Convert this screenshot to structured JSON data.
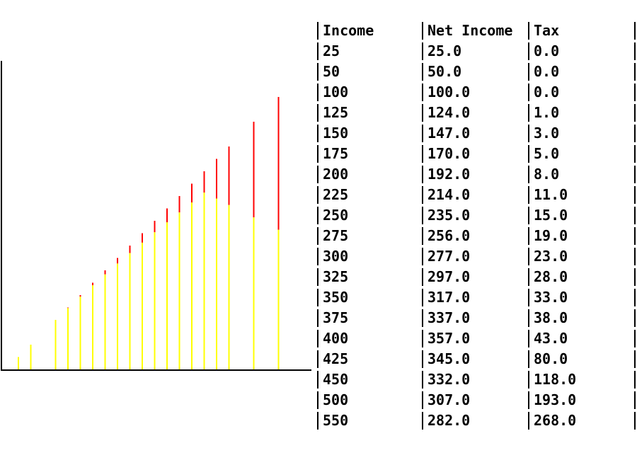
{
  "table": {
    "headers": [
      "Income",
      "Net Income",
      "Tax"
    ],
    "rows": [
      [
        "25",
        "25.0",
        "0.0"
      ],
      [
        "50",
        "50.0",
        "0.0"
      ],
      [
        "100",
        "100.0",
        "0.0"
      ],
      [
        "125",
        "124.0",
        "1.0"
      ],
      [
        "150",
        "147.0",
        "3.0"
      ],
      [
        "175",
        "170.0",
        "5.0"
      ],
      [
        "200",
        "192.0",
        "8.0"
      ],
      [
        "225",
        "214.0",
        "11.0"
      ],
      [
        "250",
        "235.0",
        "15.0"
      ],
      [
        "275",
        "256.0",
        "19.0"
      ],
      [
        "300",
        "277.0",
        "23.0"
      ],
      [
        "325",
        "297.0",
        "28.0"
      ],
      [
        "350",
        "317.0",
        "33.0"
      ],
      [
        "375",
        "337.0",
        "38.0"
      ],
      [
        "400",
        "357.0",
        "43.0"
      ],
      [
        "425",
        "345.0",
        "80.0"
      ],
      [
        "450",
        "332.0",
        "118.0"
      ],
      [
        "500",
        "307.0",
        "193.0"
      ],
      [
        "550",
        "282.0",
        "268.0"
      ]
    ]
  },
  "chart_data": {
    "type": "bar",
    "stacked": true,
    "x": [
      25,
      50,
      100,
      125,
      150,
      175,
      200,
      225,
      250,
      275,
      300,
      325,
      350,
      375,
      400,
      425,
      450,
      500,
      550
    ],
    "series": [
      {
        "values": [
          25,
          50,
          100,
          124,
          147,
          170,
          192,
          214,
          235,
          256,
          277,
          297,
          317,
          337,
          357,
          345,
          332,
          307,
          282
        ],
        "color": "#ffff00"
      },
      {
        "values": [
          0,
          0,
          0,
          1,
          3,
          5,
          8,
          11,
          15,
          19,
          23,
          28,
          33,
          38,
          43,
          80,
          118,
          193,
          268
        ],
        "color": "#ff0000"
      }
    ],
    "ylim": [
      0,
      600
    ],
    "grid": false,
    "legend": "none",
    "axis_color": "#000000"
  }
}
